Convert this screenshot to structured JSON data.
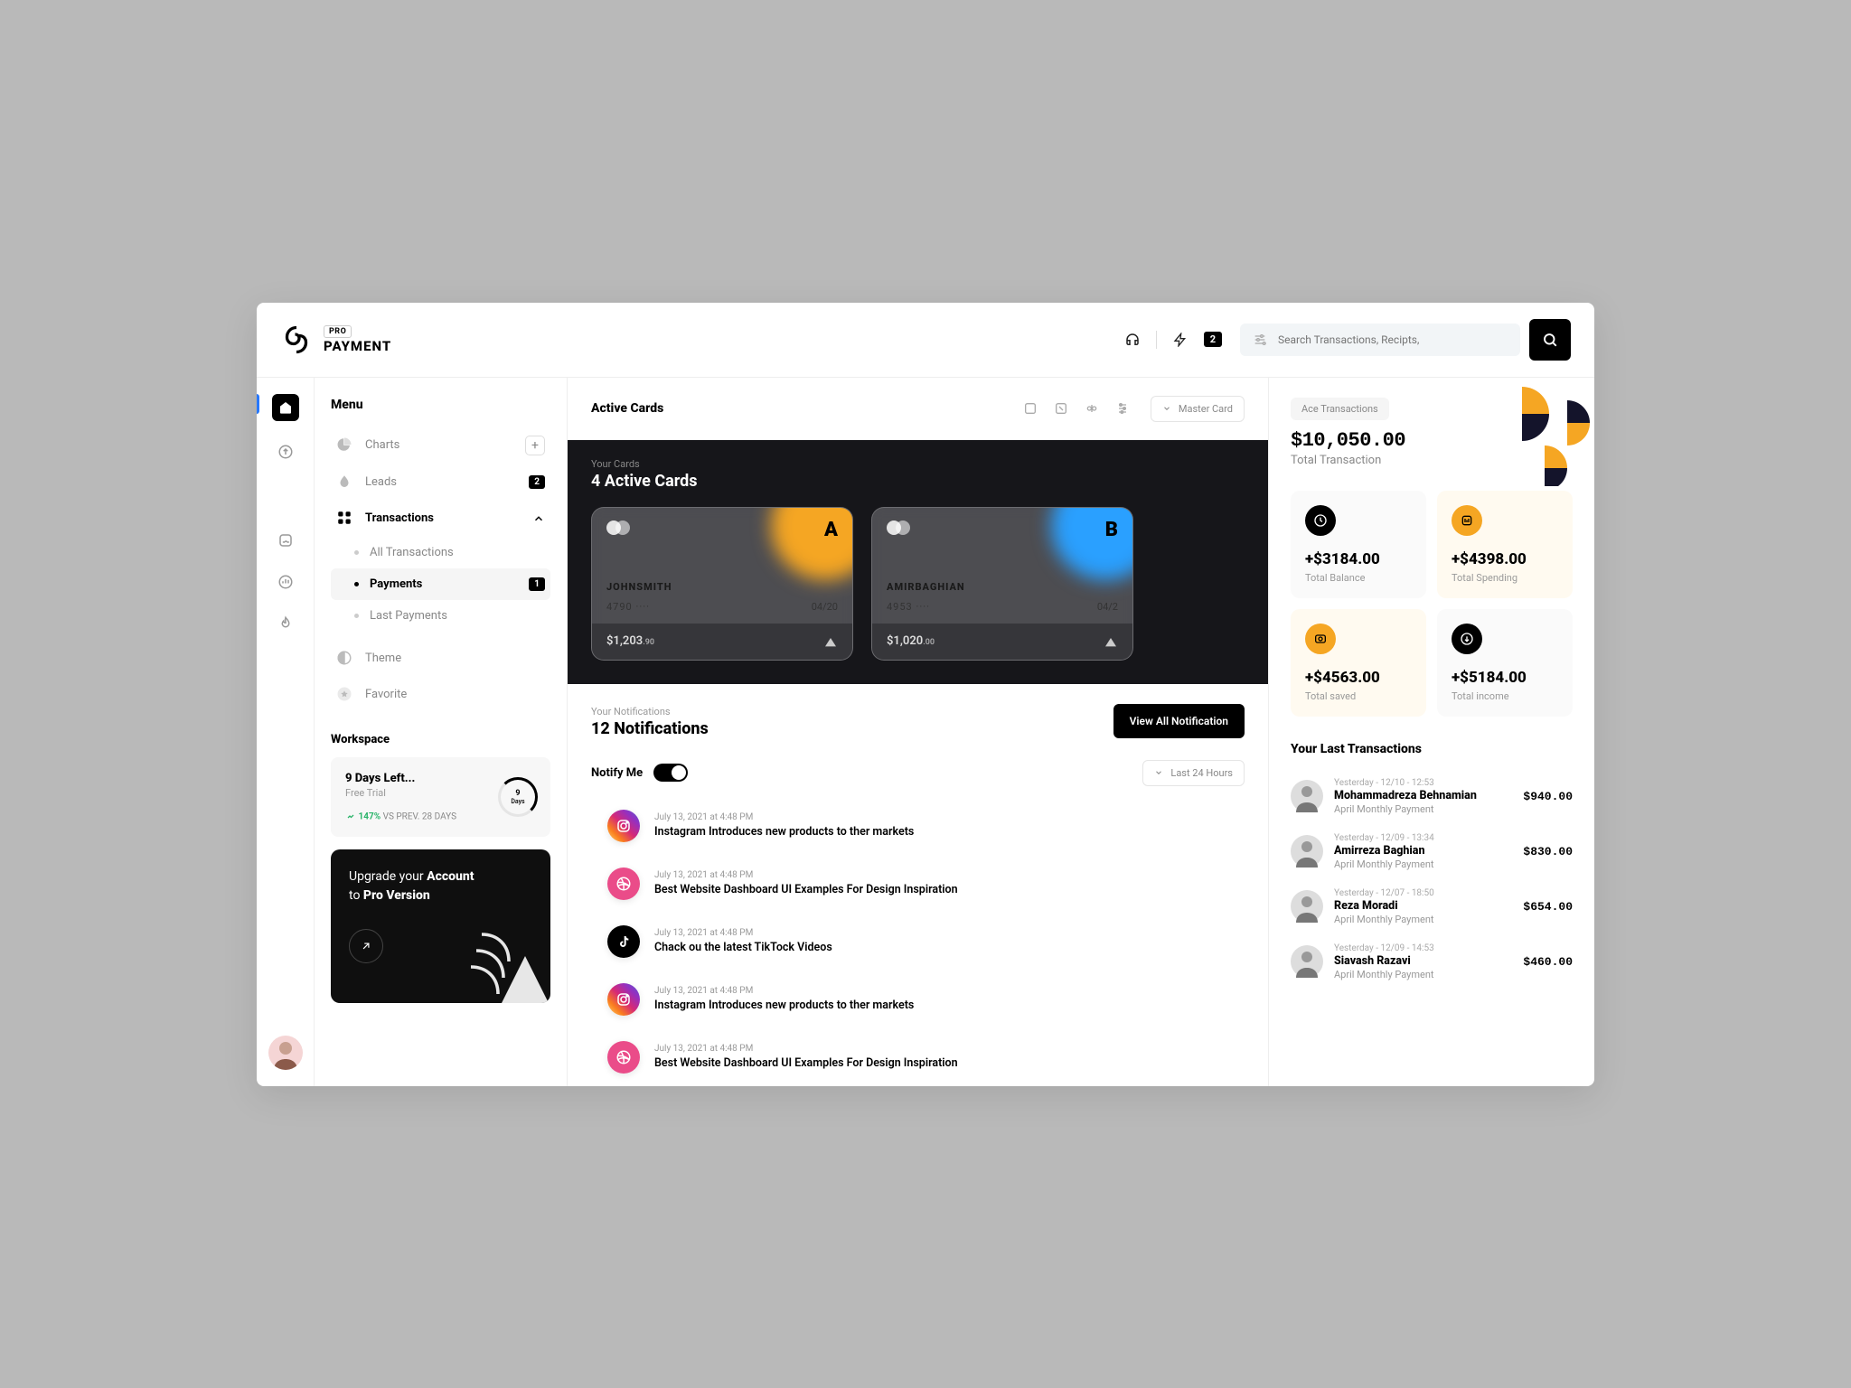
{
  "brand": {
    "pro": "PRO",
    "name": "PAYMENT"
  },
  "header": {
    "badge": "2",
    "search_placeholder": "Search Transactions, Recipts,"
  },
  "sidebar": {
    "menu_title": "Menu",
    "charts": "Charts",
    "leads": "Leads",
    "leads_badge": "2",
    "transactions": "Transactions",
    "all_tx": "All Transactions",
    "payments": "Payments",
    "payments_badge": "1",
    "last_payments": "Last Payments",
    "theme": "Theme",
    "favorite": "Favorite",
    "workspace": "Workspace",
    "trial_title": "9 Days Left...",
    "trial_sub": "Free Trial",
    "trial_pct": "147%",
    "trial_vs": " VS PREV. 28 DAYS",
    "trial_days": "9",
    "trial_days_lbl": "Days",
    "upgrade_l1": "Upgrade your ",
    "upgrade_b1": "Account",
    "upgrade_l2": "to ",
    "upgrade_b2": "Pro Version"
  },
  "active_cards": {
    "title": "Active Cards",
    "dropdown": "Master Card",
    "sub": "Your Cards",
    "count_title": "4 Active Cards",
    "cards": [
      {
        "letter": "A",
        "name": "JOHNSMITH",
        "num": "4790 ····",
        "exp": "04/20",
        "bal": "$1,203",
        "cents": ".90"
      },
      {
        "letter": "B",
        "name": "AMIRBAGHIAN",
        "num": "4953 ····",
        "exp": "04/2",
        "bal": "$1,020",
        "cents": ".00"
      }
    ]
  },
  "notifications": {
    "sub": "Your Notifications",
    "title": "12 Notifications",
    "view_all": "View All Notification",
    "notify_me": "Notify Me",
    "filter": "Last 24 Hours",
    "items": [
      {
        "icon": "ig",
        "time": "July 13, 2021 at 4:48 PM",
        "text": "Instagram Introduces new products to ther markets"
      },
      {
        "icon": "dr",
        "time": "July 13, 2021 at 4:48 PM",
        "text": "Best Website Dashboard UI Examples For Design Inspiration"
      },
      {
        "icon": "tt",
        "time": "July 13, 2021 at 4:48 PM",
        "text": "Chack ou the latest TikTock Videos"
      },
      {
        "icon": "ig",
        "time": "July 13, 2021 at 4:48 PM",
        "text": "Instagram Introduces new products to ther markets"
      },
      {
        "icon": "dr",
        "time": "July 13, 2021 at 4:48 PM",
        "text": "Best Website Dashboard UI Examples For Design Inspiration"
      }
    ]
  },
  "ace": {
    "pill": "Ace Transactions",
    "amount": "$10,050.00",
    "sub": "Total Transaction",
    "stats": [
      {
        "val": "+$3184.00",
        "lbl": "Total Balance",
        "ic": "dark",
        "bg": ""
      },
      {
        "val": "+$4398.00",
        "lbl": "Total Spending",
        "ic": "gold",
        "bg": "y"
      },
      {
        "val": "+$4563.00",
        "lbl": "Total saved",
        "ic": "gold",
        "bg": "y"
      },
      {
        "val": "+$5184.00",
        "lbl": "Total income",
        "ic": "dark",
        "bg": ""
      }
    ]
  },
  "last_tx": {
    "title": "Your Last Transactions",
    "items": [
      {
        "time": "Yesterday - 12/10 - 12:53",
        "name": "Mohammadreza Behnamian",
        "desc": "April Monthly Payment",
        "amt": "$940.00"
      },
      {
        "time": "Yesterday - 12/09 - 13:34",
        "name": "Amirreza Baghian",
        "desc": "April Monthly Payment",
        "amt": "$830.00"
      },
      {
        "time": "Yesterday - 12/07 - 18:50",
        "name": "Reza Moradi",
        "desc": "April Monthly Payment",
        "amt": "$654.00"
      },
      {
        "time": "Yesterday - 12/09 - 14:53",
        "name": "Siavash Razavi",
        "desc": "April Monthly Payment",
        "amt": "$460.00"
      }
    ]
  }
}
